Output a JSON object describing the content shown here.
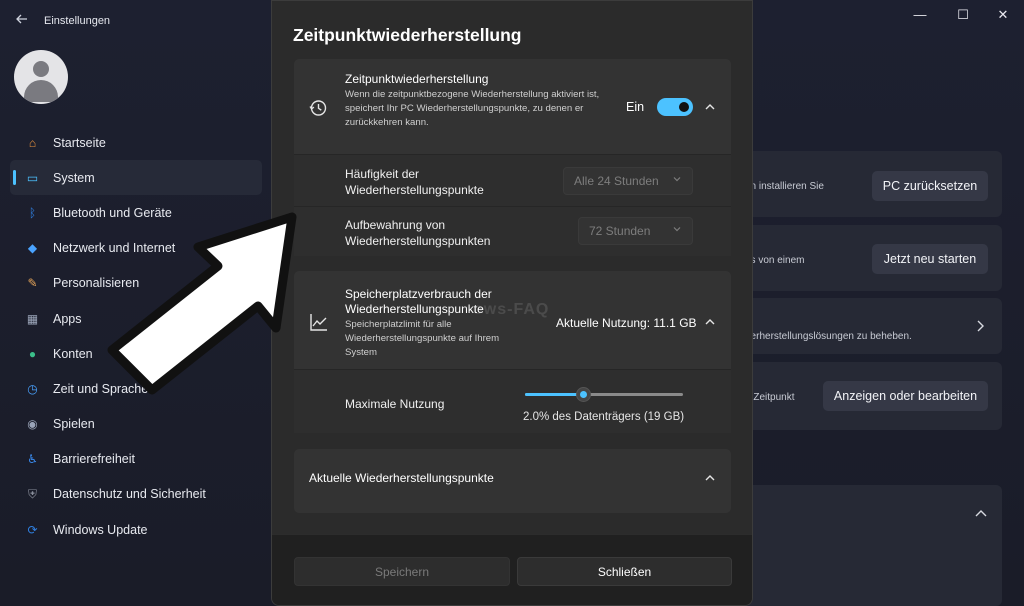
{
  "window": {
    "app_title": "Einstellungen",
    "back_icon": "back-arrow-icon",
    "minimize_glyph": "—",
    "maximize_glyph": "☐",
    "close_glyph": "✕"
  },
  "sidebar": {
    "items": [
      {
        "label": "Startseite",
        "icon": "home-icon",
        "color": "#e8913c"
      },
      {
        "label": "System",
        "icon": "system-icon",
        "color": "#4cc2ff"
      },
      {
        "label": "Bluetooth und Geräte",
        "icon": "bluetooth-icon",
        "color": "#2f7fe0"
      },
      {
        "label": "Netzwerk und Internet",
        "icon": "wifi-icon",
        "color": "#4aa3ff"
      },
      {
        "label": "Personalisieren",
        "icon": "brush-icon",
        "color": "#e7a65a"
      },
      {
        "label": "Apps",
        "icon": "apps-icon",
        "color": "#9aa4b8"
      },
      {
        "label": "Konten",
        "icon": "account-icon",
        "color": "#3bbf8a"
      },
      {
        "label": "Zeit und Sprache",
        "icon": "clock-language-icon",
        "color": "#4aa3ff"
      },
      {
        "label": "Spielen",
        "icon": "gamepad-icon",
        "color": "#9aa4b8"
      },
      {
        "label": "Barrierefreiheit",
        "icon": "accessibility-icon",
        "color": "#3a8cf0"
      },
      {
        "label": "Datenschutz und Sicherheit",
        "icon": "shield-icon",
        "color": "#8a8f9c"
      },
      {
        "label": "Windows Update",
        "icon": "update-icon",
        "color": "#2f7fe0"
      }
    ],
    "active_index": 1
  },
  "background": {
    "reset_text": "nn installieren Sie",
    "reset_button": "PC zurücksetzen",
    "restart_text": "ns von einem",
    "restart_button": "Jetzt neu starten",
    "troubleshoot_text": "derherstellungslösungen zu beheben.",
    "restore_text": "n Zeitpunkt",
    "restore_button": "Anzeigen oder bearbeiten"
  },
  "dialog": {
    "title": "Zeitpunktwiederherstellung",
    "main_card": {
      "title": "Zeitpunktwiederherstellung",
      "description": "Wenn die zeitpunktbezogene Wiederherstellung aktiviert ist, speichert Ihr PC Wiederherstellungspunkte, zu denen er zurückkehren kann.",
      "toggle_label": "Ein",
      "toggle_on": true,
      "icon": "restore-history-icon"
    },
    "frequency": {
      "label_line1": "Häufigkeit der",
      "label_line2": "Wiederherstellungspunkte",
      "value": "Alle 24 Stunden"
    },
    "retention": {
      "label_line1": "Aufbewahrung von",
      "label_line2": "Wiederherstellungspunkten",
      "value": "72 Stunden"
    },
    "storage_card": {
      "title_line1": "Speicherplatzverbrauch der",
      "title_line2": "Wiederherstellungspunkte",
      "description": "Speicherplatzlimit für alle Wiederherstellungspunkte auf Ihrem System",
      "usage": "Aktuelle Nutzung: 11.1 GB",
      "icon": "chart-line-icon"
    },
    "max_usage": {
      "label": "Maximale Nutzung",
      "slider_fraction": 0.37,
      "caption": "2.0% des Datenträgers (19 GB)"
    },
    "current_points": {
      "title": "Aktuelle Wiederherstellungspunkte"
    },
    "buttons": {
      "save": "Speichern",
      "close": "Schließen"
    },
    "watermark": "ows-FAQ"
  },
  "colors": {
    "accent": "#4cc2ff",
    "dialog_bg": "#2b2b2b",
    "card_bg": "#333333"
  }
}
